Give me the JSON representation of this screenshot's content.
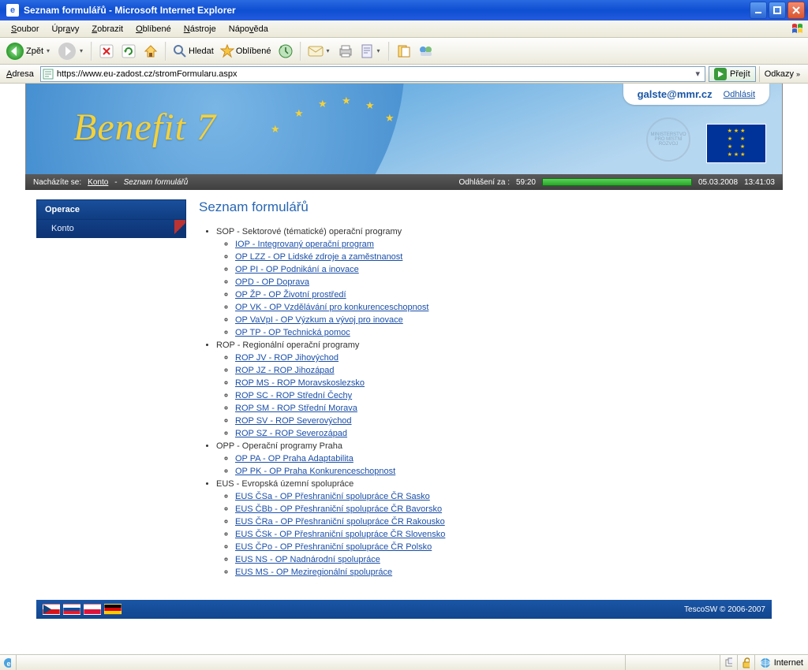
{
  "window": {
    "title": "Seznam formulářů - Microsoft Internet Explorer",
    "ieGlyph": "e"
  },
  "menu": {
    "items": [
      "Soubor",
      "Úpravy",
      "Zobrazit",
      "Oblíbené",
      "Nástroje",
      "Nápověda"
    ]
  },
  "toolbar": {
    "back": "Zpět",
    "search": "Hledat",
    "favorites": "Oblíbené"
  },
  "address": {
    "label": "Adresa",
    "url": "https://www.eu-zadost.cz/stromFormularu.aspx",
    "go": "Přejít",
    "links": "Odkazy"
  },
  "banner": {
    "brand": "Benefit 7"
  },
  "user": {
    "email": "galste@mmr.cz",
    "logout": "Odhlásit"
  },
  "breadcrumb": {
    "prefix": "Nacházíte se:",
    "konto": "Konto",
    "sep": " - ",
    "page": "Seznam formulářů"
  },
  "session": {
    "logoutLabel": "Odhlášení za :",
    "logoutTime": "59:20",
    "date": "05.03.2008",
    "time": "13:41:03"
  },
  "sidebar": {
    "header": "Operace",
    "items": [
      {
        "label": "Konto"
      }
    ]
  },
  "content": {
    "heading": "Seznam formulářů",
    "groups": [
      {
        "label": "SOP - Sektorové (tématické) operační programy",
        "items": [
          "IOP - Integrovaný operační program",
          "OP LZZ - OP Lidské zdroje a zaměstnanost",
          "OP PI - OP Podnikání a inovace",
          "OPD - OP Doprava",
          "OP ŽP - OP Životní prostředí",
          "OP VK - OP Vzdělávání pro konkurenceschopnost",
          "OP VaVpI - OP Výzkum a vývoj pro inovace",
          "OP TP - OP Technická pomoc"
        ]
      },
      {
        "label": "ROP - Regionální operační programy",
        "items": [
          "ROP JV - ROP Jihovýchod",
          "ROP JZ - ROP Jihozápad",
          "ROP MS - ROP Moravskoslezsko",
          "ROP SC - ROP Střední Čechy",
          "ROP SM - ROP Střední Morava",
          "ROP SV - ROP Severovýchod",
          "ROP SZ - ROP Severozápad"
        ]
      },
      {
        "label": "OPP - Operační programy Praha",
        "items": [
          "OP PA - OP Praha Adaptabilita",
          "OP PK - OP Praha Konkurenceschopnost"
        ]
      },
      {
        "label": "EUS - Evropská územní spolupráce",
        "items": [
          "EUS ČSa - OP Přeshraniční spolupráce ČR Sasko",
          "EUS ČBb - OP Přeshraniční spolupráce ČR Bavorsko",
          "EUS ČRa - OP Přeshraniční spolupráce ČR Rakousko",
          "EUS ČSk - OP Přeshraniční spolupráce ČR Slovensko",
          "EUS ČPo - OP Přeshraniční spolupráce ČR Polsko",
          "EUS NS - OP Nadnárodní spolupráce",
          "EUS MS - OP Meziregionální spolupráce"
        ]
      }
    ]
  },
  "footer": {
    "copy": "TescoSW © 2006-2007"
  },
  "iestatus": {
    "zone": "Internet"
  }
}
